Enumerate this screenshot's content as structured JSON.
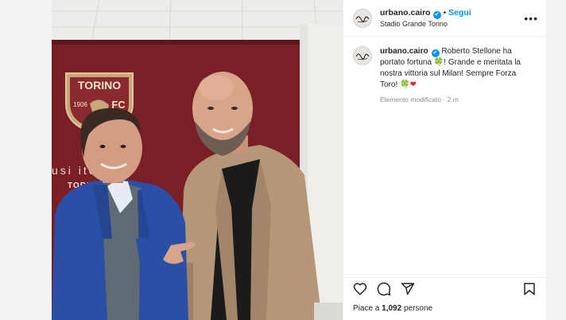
{
  "post": {
    "username": "urbano.cairo",
    "verified_mark": "✔",
    "follow_label": "Segui",
    "separator": "•",
    "location": "Stadio Grande Torino",
    "more_label": "•••"
  },
  "caption": {
    "username": "urbano.cairo",
    "text_part1": "Roberto Stellone ha portato fortuna",
    "text_part2": "! Grande e meritata la nostra vittoria sul Milan! Sempre Forza Toro!",
    "emoji_clover": "🍀",
    "emoji_heart": "❤",
    "edited_label": "Elemento modificato",
    "meta_separator": "·",
    "time_ago": "2 m"
  },
  "likes": {
    "prefix": "Piace a",
    "count": "1,092",
    "suffix": "persone"
  },
  "photo": {
    "club_name": "TORINO",
    "club_year": "1906",
    "club_letters": "FC",
    "wall_text": "usi         ite",
    "wall_text_lower": "TORIN"
  },
  "icons": {
    "like": "heart-outline-icon",
    "comment": "comment-icon",
    "share": "paper-plane-icon",
    "save": "bookmark-icon",
    "more": "more-horizontal-icon",
    "verified": "verified-badge-icon"
  },
  "colors": {
    "accent": "#0095f6",
    "text": "#262626",
    "muted": "#8e8e8e",
    "wall_maroon": "#7a1f26"
  }
}
